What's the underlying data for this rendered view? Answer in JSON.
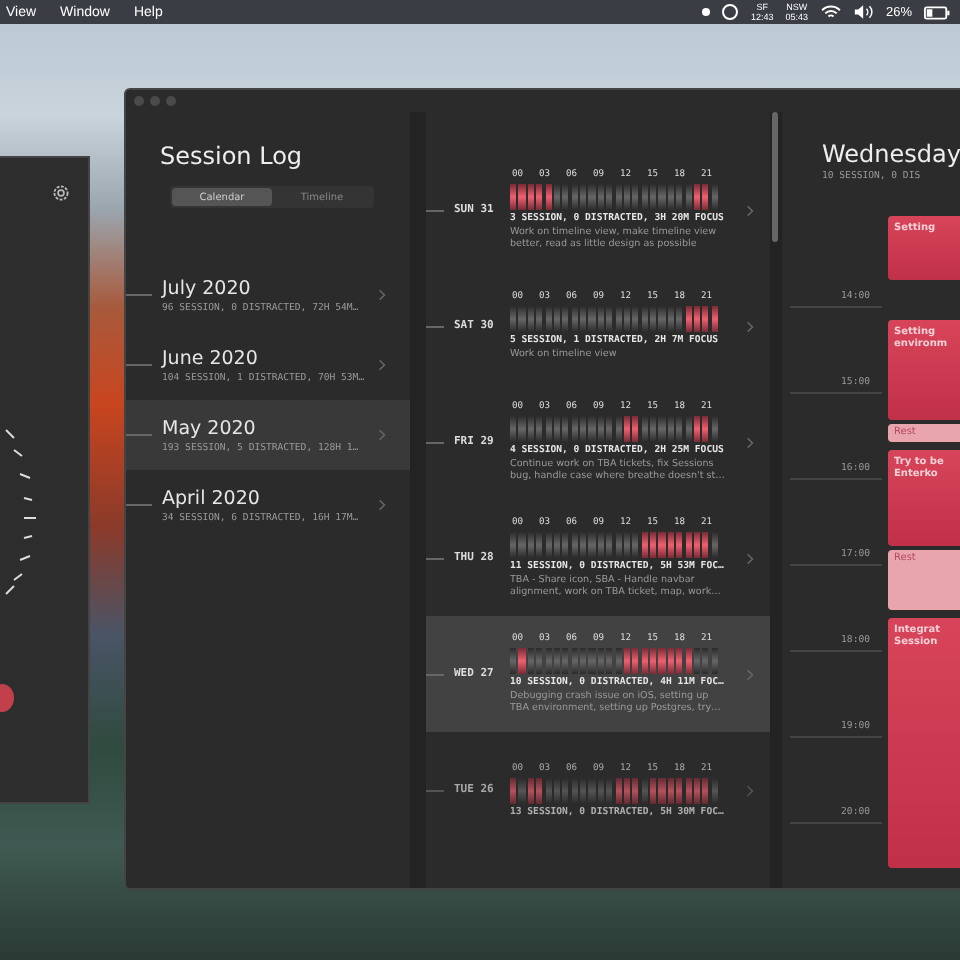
{
  "menu_bar": {
    "menus": [
      "View",
      "Window",
      "Help"
    ],
    "clocks": [
      {
        "zone": "SF",
        "time": "12:43"
      },
      {
        "zone": "NSW",
        "time": "05:43"
      }
    ],
    "battery": "26%"
  },
  "session_log": {
    "title": "Session Log",
    "tabs": [
      {
        "label": "Calendar",
        "selected": true
      },
      {
        "label": "Timeline",
        "selected": false
      }
    ],
    "months": [
      {
        "title": "July 2020",
        "summary": "96 SESSION, 0 DISTRACTED, 72H 54M…",
        "selected": false
      },
      {
        "title": "June 2020",
        "summary": "104 SESSION, 1 DISTRACTED, 70H 53M…",
        "selected": false
      },
      {
        "title": "May 2020",
        "summary": "193 SESSION, 5 DISTRACTED, 128H 1…",
        "selected": true
      },
      {
        "title": "April 2020",
        "summary": "34 SESSION, 6 DISTRACTED, 16H 17M…",
        "selected": false
      }
    ]
  },
  "days": [
    {
      "label": "SUN 31",
      "hour_labels": [
        "00",
        "03",
        "06",
        "09",
        "12",
        "15",
        "18",
        "21"
      ],
      "hours": [
        true,
        true,
        true,
        true,
        true,
        false,
        false,
        false,
        false,
        false,
        false,
        false,
        false,
        false,
        false,
        false,
        false,
        false,
        false,
        false,
        false,
        true,
        true,
        false
      ],
      "summary": "3 SESSION, 0 DISTRACTED, 3H 20M FOCUS",
      "description": "Work on timeline view, make timeline view better, read as little design as possible",
      "selected": false,
      "dimmed": false
    },
    {
      "label": "SAT 30",
      "hour_labels": [
        "00",
        "03",
        "06",
        "09",
        "12",
        "15",
        "18",
        "21"
      ],
      "hours": [
        false,
        false,
        false,
        false,
        false,
        false,
        false,
        false,
        false,
        false,
        false,
        false,
        false,
        false,
        false,
        false,
        false,
        false,
        false,
        false,
        true,
        true,
        true,
        true
      ],
      "summary": "5 SESSION, 1 DISTRACTED, 2H 7M FOCUS",
      "description": "Work on timeline view",
      "selected": false,
      "dimmed": false
    },
    {
      "label": "FRI 29",
      "hour_labels": [
        "00",
        "03",
        "06",
        "09",
        "12",
        "15",
        "18",
        "21"
      ],
      "hours": [
        false,
        false,
        false,
        false,
        false,
        false,
        false,
        false,
        false,
        false,
        false,
        false,
        false,
        true,
        true,
        false,
        false,
        false,
        false,
        false,
        false,
        true,
        true,
        false
      ],
      "summary": "4 SESSION, 0 DISTRACTED, 2H 25M FOCUS",
      "description": "Continue work on TBA tickets, fix Sessions bug, handle case where breathe doesn't st…",
      "selected": false,
      "dimmed": false
    },
    {
      "label": "THU 28",
      "hour_labels": [
        "00",
        "03",
        "06",
        "09",
        "12",
        "15",
        "18",
        "21"
      ],
      "hours": [
        false,
        false,
        false,
        false,
        false,
        false,
        false,
        false,
        false,
        false,
        false,
        false,
        false,
        false,
        false,
        true,
        true,
        true,
        true,
        true,
        true,
        true,
        true,
        false
      ],
      "summary": "11 SESSION, 0 DISTRACTED, 5H 53M FOC…",
      "description": "TBA - Share icon, SBA - Handle navbar alignment, work on TBA ticket, map, work…",
      "selected": false,
      "dimmed": false
    },
    {
      "label": "WED 27",
      "hour_labels": [
        "00",
        "03",
        "06",
        "09",
        "12",
        "15",
        "18",
        "21"
      ],
      "hours": [
        false,
        true,
        false,
        false,
        false,
        false,
        false,
        false,
        false,
        false,
        false,
        false,
        false,
        true,
        true,
        true,
        true,
        true,
        true,
        true,
        true,
        false,
        false,
        false
      ],
      "summary": "10 SESSION, 0 DISTRACTED, 4H 11M FOC…",
      "description": "Debugging crash issue on iOS, setting up TBA environment, setting up Postgres, try…",
      "selected": true,
      "dimmed": false
    },
    {
      "label": "TUE 26",
      "hour_labels": [
        "00",
        "03",
        "06",
        "09",
        "12",
        "15",
        "18",
        "21"
      ],
      "hours": [
        true,
        false,
        true,
        true,
        false,
        false,
        false,
        false,
        false,
        false,
        false,
        false,
        true,
        true,
        true,
        false,
        true,
        true,
        true,
        true,
        true,
        true,
        true,
        false
      ],
      "summary": "13 SESSION, 0 DISTRACTED, 5H 30M FOC…",
      "selected": false,
      "dimmed": true
    }
  ],
  "day_detail": {
    "title": "Wednesday",
    "summary": "10 SESSION, 0 DIS",
    "times": [
      "14:00",
      "15:00",
      "16:00",
      "17:00",
      "18:00",
      "19:00",
      "20:00"
    ],
    "events": [
      {
        "kind": "session",
        "lines": [
          "Setting"
        ]
      },
      {
        "kind": "session",
        "lines": [
          "Setting",
          "environm"
        ]
      },
      {
        "kind": "rest",
        "lines": [
          "Rest"
        ]
      },
      {
        "kind": "session",
        "lines": [
          "Try to be",
          "Enterko"
        ]
      },
      {
        "kind": "rest",
        "lines": [
          "Rest"
        ]
      },
      {
        "kind": "session",
        "lines": [
          "Integrat",
          "Session"
        ]
      }
    ]
  }
}
